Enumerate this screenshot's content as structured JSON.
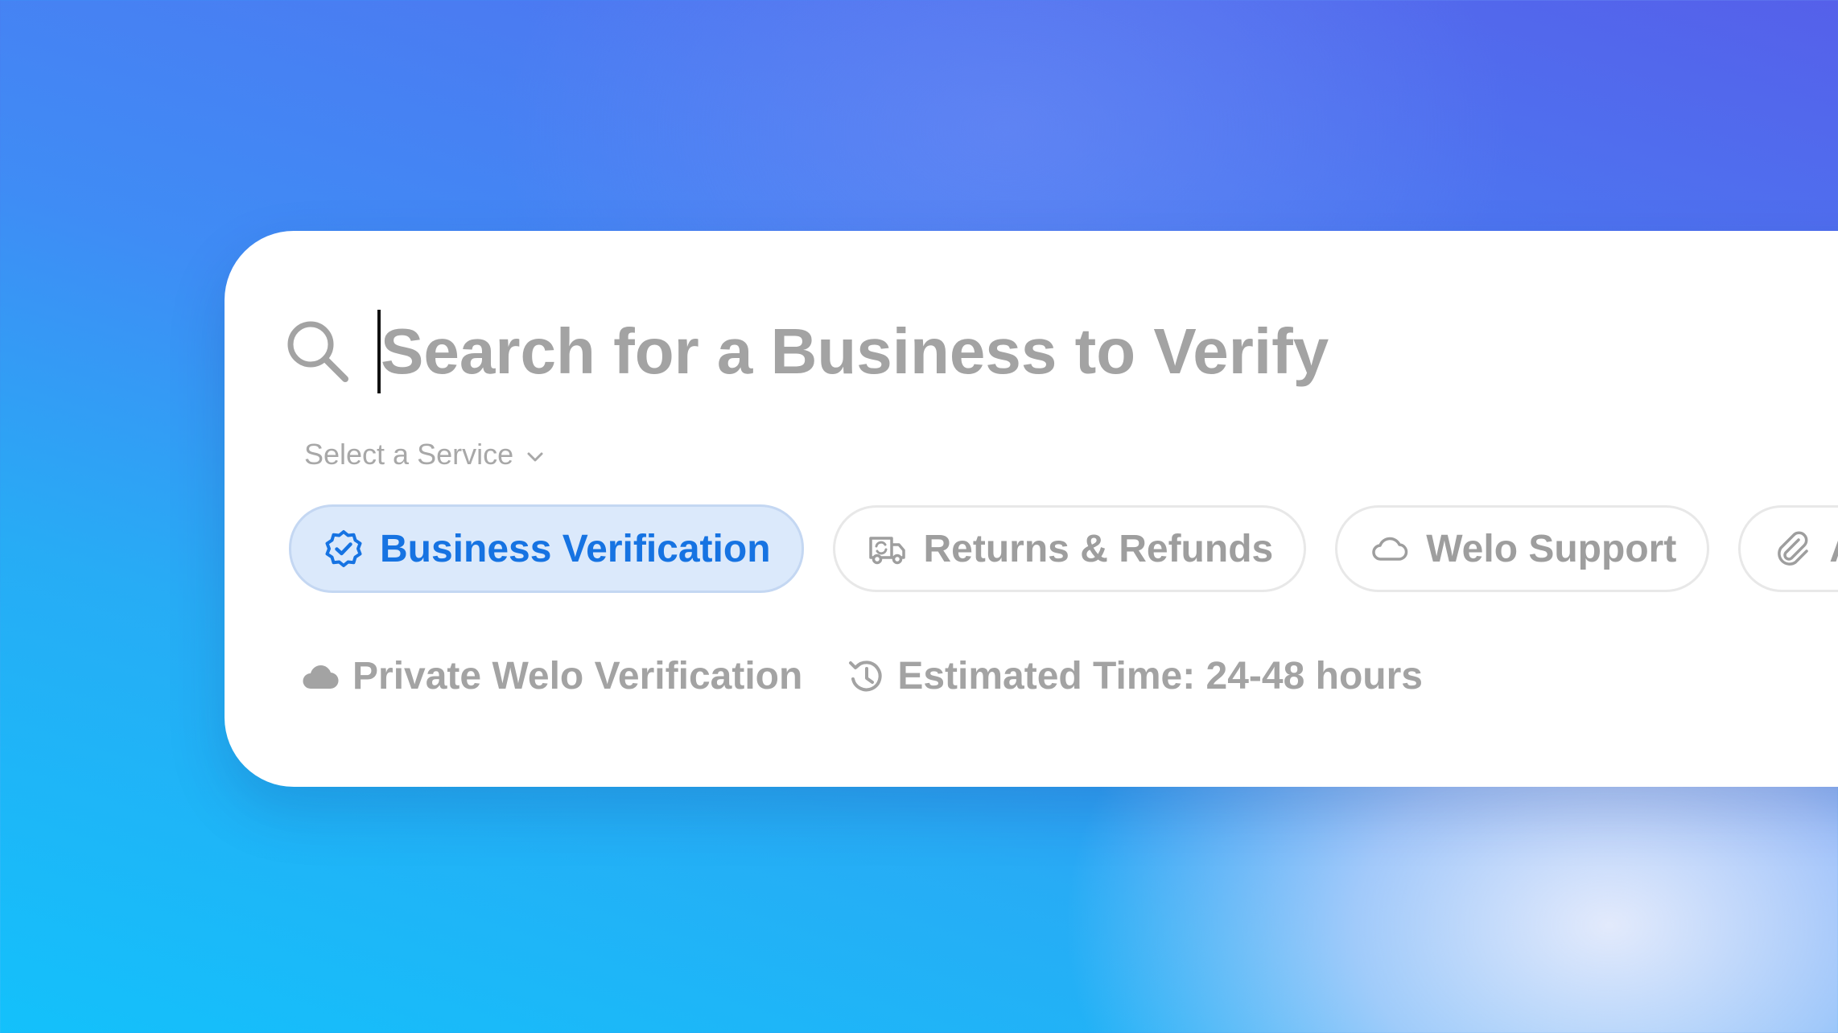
{
  "search": {
    "placeholder": "Search for a Business to Verify",
    "value": ""
  },
  "service_select": {
    "label": "Select a Service"
  },
  "services": [
    {
      "label": "Business Verification",
      "icon": "verified-badge-icon",
      "active": true
    },
    {
      "label": "Returns & Refunds",
      "icon": "delivery-truck-icon",
      "active": false
    },
    {
      "label": "Welo Support",
      "icon": "cloud-outline-icon",
      "active": false
    },
    {
      "label": "A",
      "icon": "paperclip-icon",
      "active": false
    }
  ],
  "meta": {
    "privacy": "Private Welo Verification",
    "estimate": "Estimated Time: 24-48 hours"
  },
  "colors": {
    "accent": "#1673e2",
    "active_chip_bg": "#dbe9fb",
    "muted_text": "#a3a3a3"
  }
}
